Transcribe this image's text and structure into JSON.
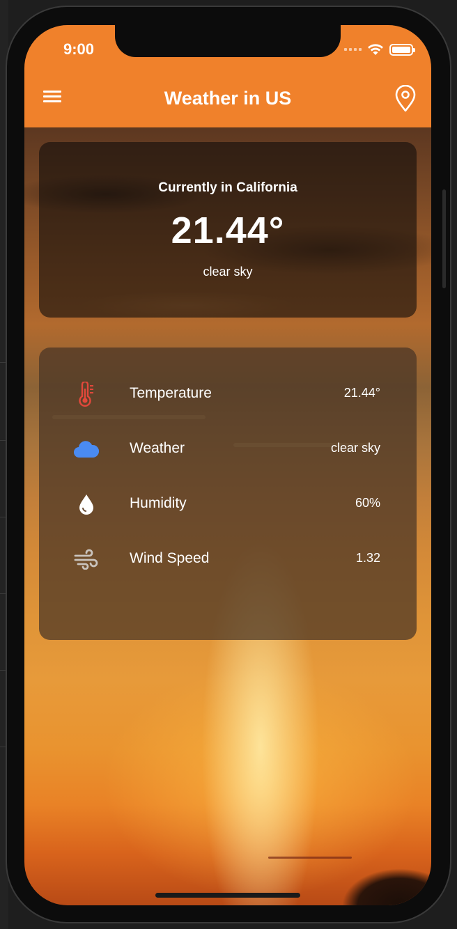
{
  "status_bar": {
    "time": "9:00"
  },
  "app_bar": {
    "title": "Weather in US"
  },
  "current": {
    "label": "Currently in California",
    "temperature": "21.44°",
    "description": "clear sky"
  },
  "details": [
    {
      "icon": "thermometer-icon",
      "label": "Temperature",
      "value": "21.44°",
      "color": "#e2483b"
    },
    {
      "icon": "cloud-icon",
      "label": "Weather",
      "value": "clear sky",
      "color": "#4a8bf2"
    },
    {
      "icon": "water-drop-icon",
      "label": "Humidity",
      "value": "60%",
      "color": "#ffffff"
    },
    {
      "icon": "wind-icon",
      "label": "Wind Speed",
      "value": "1.32",
      "color": "#c9c3bd"
    }
  ],
  "colors": {
    "app_bar": "#f0812b"
  }
}
